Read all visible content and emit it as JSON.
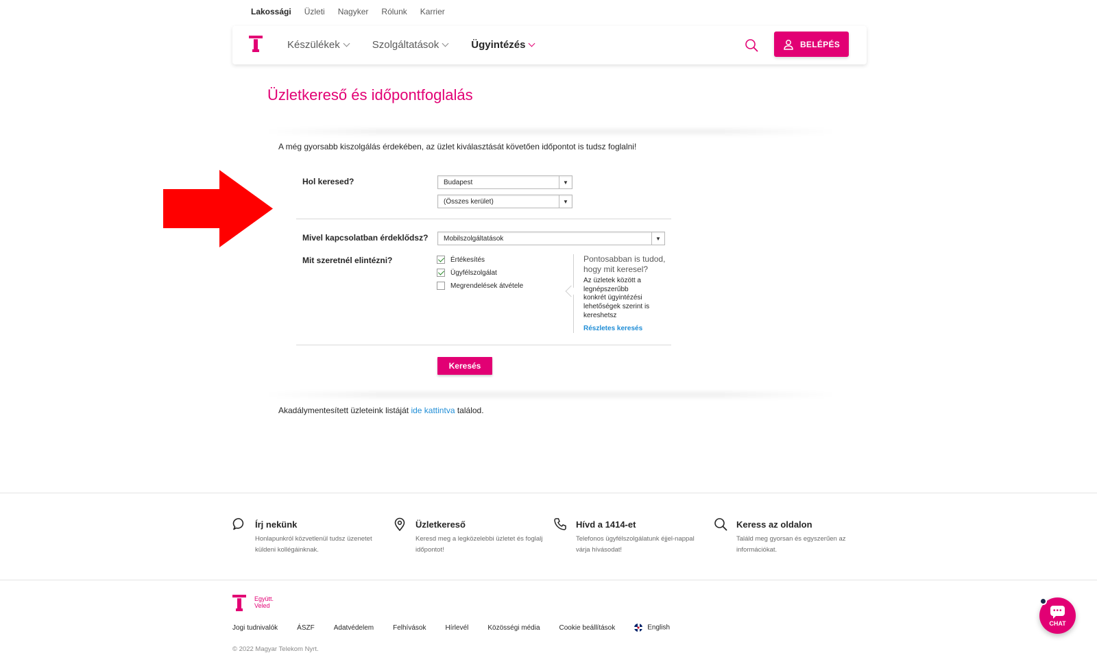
{
  "top_links": [
    {
      "label": "Lakossági",
      "active": true
    },
    {
      "label": "Üzleti",
      "active": false
    },
    {
      "label": "Nagyker",
      "active": false
    },
    {
      "label": "Rólunk",
      "active": false
    },
    {
      "label": "Karrier",
      "active": false
    }
  ],
  "header": {
    "nav": [
      {
        "label": "Készülékek",
        "active": false
      },
      {
        "label": "Szolgáltatások",
        "active": false
      },
      {
        "label": "Ügyintézés",
        "active": true
      }
    ],
    "login_label": "BELÉPÉS"
  },
  "page": {
    "title": "Üzletkereső és időpontfoglalás",
    "intro": "A még gyorsabb kiszolgálás érdekében, az üzlet kiválasztását követően időpontot is tudsz foglalni!"
  },
  "form": {
    "where_label": "Hol keresed?",
    "city_value": "Budapest",
    "district_value": "(Összes kerület)",
    "topic_label": "Mivel kapcsolatban érdeklődsz?",
    "topic_value": "Mobilszolgáltatások",
    "task_label": "Mit szeretnél elintézni?",
    "options": [
      {
        "label": "Értékesítés",
        "checked": true
      },
      {
        "label": "Ügyfélszolgálat",
        "checked": true
      },
      {
        "label": "Megrendelések átvétele",
        "checked": false
      }
    ],
    "hint_title": "Pontosabban is tudod, hogy mit keresel?",
    "hint_body": "Az üzletek között a legnépszerűbb konkrét ügyintézési lehetőségek szerint is kereshetsz",
    "hint_link": "Részletes keresés",
    "search_button": "Keresés"
  },
  "accessibility": {
    "prefix": "Akadálymentesített üzleteink listáját",
    "link": "ide kattintva",
    "suffix": "találod."
  },
  "contacts": [
    {
      "icon": "speech-bubble-icon",
      "title": "Írj nekünk",
      "desc": "Honlapunkról közvetlenül tudsz üzenetet küldeni kollégáinknak."
    },
    {
      "icon": "location-pin-icon",
      "title": "Üzletkereső",
      "desc": "Keresd meg a legközelebbi üzletet és foglalj időpontot!"
    },
    {
      "icon": "phone-icon",
      "title": "Hívd a 1414-et",
      "desc": "Telefonos ügyfélszolgálatunk éjjel-nappal várja hívásodat!"
    },
    {
      "icon": "search-icon",
      "title": "Keress az oldalon",
      "desc": "Találd meg gyorsan és egyszerűen az információkat."
    }
  ],
  "footer": {
    "slogan_line1": "Együtt.",
    "slogan_line2": "Veled",
    "links": [
      "Jogi tudnivalók",
      "ÁSZF",
      "Adatvédelem",
      "Felhívások",
      "Hírlevél",
      "Közösségi média",
      "Cookie beállítások"
    ],
    "language": "English",
    "copyright": "© 2022 Magyar Telekom Nyrt."
  },
  "chat": {
    "label": "CHAT"
  },
  "colors": {
    "brand": "#e20074",
    "link": "#1f8dd6",
    "annotation_arrow": "#ff0000"
  }
}
